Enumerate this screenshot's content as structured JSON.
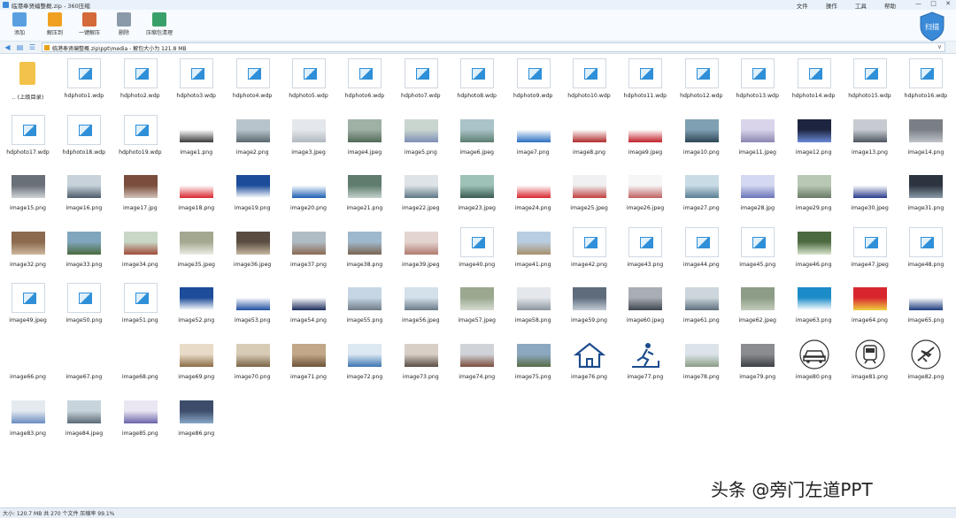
{
  "window": {
    "title": "临港奉贤编整概.zip - 360压缩",
    "menus": [
      "文件",
      "操作",
      "工具",
      "帮助"
    ],
    "controls": [
      "—",
      "□",
      "✕"
    ]
  },
  "toolbar": {
    "buttons": [
      {
        "label": "添加",
        "icon": "add-icon",
        "color": "#5aa0e0"
      },
      {
        "label": "解压到",
        "icon": "extract-to-icon",
        "color": "#f0a020"
      },
      {
        "label": "一键解压",
        "icon": "one-click-extract-icon",
        "color": "#d46a3a"
      },
      {
        "label": "删除",
        "icon": "delete-icon",
        "color": "#8a9aa8"
      },
      {
        "label": "压缩包清理",
        "icon": "archive-clean-icon",
        "color": "#3aa06a"
      }
    ],
    "shield_label": "扫描"
  },
  "address": {
    "path": "临港奉贤编整概.zip\\ppt\\media - 解包大小为 121.8 MB"
  },
  "files": [
    {
      "name": ".. (上级目录)",
      "kind": "folder"
    },
    {
      "name": "hdphoto1.wdp",
      "kind": "doc"
    },
    {
      "name": "hdphoto2.wdp",
      "kind": "doc"
    },
    {
      "name": "hdphoto3.wdp",
      "kind": "doc"
    },
    {
      "name": "hdphoto4.wdp",
      "kind": "doc"
    },
    {
      "name": "hdphoto5.wdp",
      "kind": "doc"
    },
    {
      "name": "hdphoto6.wdp",
      "kind": "doc"
    },
    {
      "name": "hdphoto7.wdp",
      "kind": "doc"
    },
    {
      "name": "hdphoto8.wdp",
      "kind": "doc"
    },
    {
      "name": "hdphoto9.wdp",
      "kind": "doc"
    },
    {
      "name": "hdphoto10.wdp",
      "kind": "doc"
    },
    {
      "name": "hdphoto11.wdp",
      "kind": "doc"
    },
    {
      "name": "hdphoto12.wdp",
      "kind": "doc"
    },
    {
      "name": "hdphoto13.wdp",
      "kind": "doc"
    },
    {
      "name": "hdphoto14.wdp",
      "kind": "doc"
    },
    {
      "name": "hdphoto15.wdp",
      "kind": "doc"
    },
    {
      "name": "hdphoto16.wdp",
      "kind": "doc"
    },
    {
      "name": "hdphoto17.wdp",
      "kind": "doc"
    },
    {
      "name": "hdphoto18.wdp",
      "kind": "doc"
    },
    {
      "name": "hdphoto19.wdp",
      "kind": "doc"
    },
    {
      "name": "image1.png",
      "kind": "img",
      "colors": [
        "#ffffff",
        "#3a3a3a"
      ]
    },
    {
      "name": "image2.png",
      "kind": "img",
      "colors": [
        "#b8c4cc",
        "#5a6870"
      ]
    },
    {
      "name": "image3.jpeg",
      "kind": "img",
      "colors": [
        "#e4e8ec",
        "#b0b8bf"
      ]
    },
    {
      "name": "image4.jpeg",
      "kind": "img",
      "colors": [
        "#9fb0a4",
        "#526a58"
      ]
    },
    {
      "name": "image5.png",
      "kind": "img",
      "colors": [
        "#c9d6d0",
        "#7d8fb5"
      ]
    },
    {
      "name": "image6.jpeg",
      "kind": "img",
      "colors": [
        "#a9c3c8",
        "#5d7e70"
      ]
    },
    {
      "name": "image7.png",
      "kind": "img",
      "colors": [
        "#ffffff",
        "#2a6fc0"
      ]
    },
    {
      "name": "image8.png",
      "kind": "img",
      "colors": [
        "#ffffff",
        "#b02b2b"
      ]
    },
    {
      "name": "image9.jpeg",
      "kind": "img",
      "colors": [
        "#ffffff",
        "#c0202a"
      ]
    },
    {
      "name": "image10.png",
      "kind": "img",
      "colors": [
        "#7f9fb2",
        "#2e4656"
      ]
    },
    {
      "name": "image11.jpeg",
      "kind": "img",
      "colors": [
        "#d9d4ea",
        "#8a86b0"
      ]
    },
    {
      "name": "image12.png",
      "kind": "img",
      "colors": [
        "#1d2440",
        "#6a8ad6"
      ]
    },
    {
      "name": "image13.png",
      "kind": "img",
      "colors": [
        "#c7cbd1",
        "#4f5660"
      ]
    },
    {
      "name": "image14.png",
      "kind": "img",
      "colors": [
        "#7a7f86",
        "#c0c4c9"
      ]
    },
    {
      "name": "image15.png",
      "kind": "img",
      "colors": [
        "#6a7078",
        "#cfd3d8"
      ]
    },
    {
      "name": "image16.png",
      "kind": "img",
      "colors": [
        "#c7d2da",
        "#4d5c6a"
      ]
    },
    {
      "name": "image17.jpg",
      "kind": "img",
      "colors": [
        "#7a4d3c",
        "#d2c2b8"
      ]
    },
    {
      "name": "image18.png",
      "kind": "img",
      "colors": [
        "#ffffff",
        "#d8262e"
      ]
    },
    {
      "name": "image19.png",
      "kind": "img",
      "colors": [
        "#1c4c9a",
        "#ffffff"
      ]
    },
    {
      "name": "image20.png",
      "kind": "img",
      "colors": [
        "#ffffff",
        "#1c5fb2"
      ]
    },
    {
      "name": "image21.png",
      "kind": "img",
      "colors": [
        "#5f7c6e",
        "#c4d2cc"
      ]
    },
    {
      "name": "image22.jpeg",
      "kind": "img",
      "colors": [
        "#dde3e6",
        "#5e7786"
      ]
    },
    {
      "name": "image23.jpeg",
      "kind": "img",
      "colors": [
        "#9ec2b8",
        "#3a5a52"
      ]
    },
    {
      "name": "image24.png",
      "kind": "img",
      "colors": [
        "#ffffff",
        "#d8262e"
      ]
    },
    {
      "name": "image25.jpeg",
      "kind": "img",
      "colors": [
        "#f0f0f2",
        "#c24040"
      ]
    },
    {
      "name": "image26.jpeg",
      "kind": "img",
      "colors": [
        "#f6f6f6",
        "#c06060"
      ]
    },
    {
      "name": "image27.png",
      "kind": "img",
      "colors": [
        "#c9dce6",
        "#5a7e94"
      ]
    },
    {
      "name": "image28.jpg",
      "kind": "img",
      "colors": [
        "#d4d8f0",
        "#6a74b8"
      ]
    },
    {
      "name": "image29.png",
      "kind": "img",
      "colors": [
        "#b8c8b4",
        "#6a7a66"
      ]
    },
    {
      "name": "image30.jpeg",
      "kind": "img",
      "colors": [
        "#ffffff",
        "#2a3c8c"
      ]
    },
    {
      "name": "image31.png",
      "kind": "img",
      "colors": [
        "#2c3440",
        "#8a9aa8"
      ]
    },
    {
      "name": "image32.png",
      "kind": "img",
      "colors": [
        "#8c6a4e",
        "#cdb89e"
      ]
    },
    {
      "name": "image33.png",
      "kind": "img",
      "colors": [
        "#7fa6bc",
        "#4a6a3e"
      ]
    },
    {
      "name": "image34.png",
      "kind": "img",
      "colors": [
        "#c9d8c6",
        "#a04a3a"
      ]
    },
    {
      "name": "image35.jpeg",
      "kind": "img",
      "colors": [
        "#a4a890",
        "#ecece4"
      ]
    },
    {
      "name": "image36.jpeg",
      "kind": "img",
      "colors": [
        "#5a4c40",
        "#c7b8a2"
      ]
    },
    {
      "name": "image37.png",
      "kind": "img",
      "colors": [
        "#b0bcc4",
        "#8a6a52"
      ]
    },
    {
      "name": "image38.png",
      "kind": "img",
      "colors": [
        "#9fb8cc",
        "#7a6450"
      ]
    },
    {
      "name": "image39.jpeg",
      "kind": "img",
      "colors": [
        "#e4d4d0",
        "#b07a70"
      ]
    },
    {
      "name": "image40.png",
      "kind": "doc"
    },
    {
      "name": "image41.png",
      "kind": "img",
      "colors": [
        "#b9cde0",
        "#a8906c"
      ]
    },
    {
      "name": "image42.png",
      "kind": "doc"
    },
    {
      "name": "image43.png",
      "kind": "doc"
    },
    {
      "name": "image44.png",
      "kind": "doc"
    },
    {
      "name": "image45.png",
      "kind": "doc"
    },
    {
      "name": "image46.png",
      "kind": "img",
      "colors": [
        "#4c6a40",
        "#d8e4cc"
      ]
    },
    {
      "name": "image47.jpeg",
      "kind": "doc"
    },
    {
      "name": "image48.png",
      "kind": "doc"
    },
    {
      "name": "image49.jpeg",
      "kind": "doc"
    },
    {
      "name": "image50.png",
      "kind": "doc"
    },
    {
      "name": "image51.png",
      "kind": "doc"
    },
    {
      "name": "image52.png",
      "kind": "img",
      "colors": [
        "#1c4c9a",
        "#ffffff"
      ]
    },
    {
      "name": "image53.png",
      "kind": "img",
      "colors": [
        "#ffffff",
        "#2050a0"
      ]
    },
    {
      "name": "image54.png",
      "kind": "img",
      "colors": [
        "#ffffff",
        "#1c2c5c"
      ]
    },
    {
      "name": "image55.png",
      "kind": "img",
      "colors": [
        "#c6d6e4",
        "#707c88"
      ]
    },
    {
      "name": "image56.jpeg",
      "kind": "img",
      "colors": [
        "#d4e0ea",
        "#6a7a86"
      ]
    },
    {
      "name": "image57.jpeg",
      "kind": "img",
      "colors": [
        "#9aa890",
        "#d8dcd2"
      ]
    },
    {
      "name": "image58.png",
      "kind": "img",
      "colors": [
        "#e4e8ec",
        "#8a949e"
      ]
    },
    {
      "name": "image59.png",
      "kind": "img",
      "colors": [
        "#5e6c7c",
        "#c4ccd6"
      ]
    },
    {
      "name": "image60.jpeg",
      "kind": "img",
      "colors": [
        "#a8aeb4",
        "#3e4650"
      ]
    },
    {
      "name": "image61.png",
      "kind": "img",
      "colors": [
        "#cdd6dc",
        "#5c6e7c"
      ]
    },
    {
      "name": "image62.jpeg",
      "kind": "img",
      "colors": [
        "#8c9c86",
        "#c4ccbc"
      ]
    },
    {
      "name": "image63.png",
      "kind": "img",
      "colors": [
        "#1c8cc8",
        "#ffffff"
      ]
    },
    {
      "name": "image64.png",
      "kind": "img",
      "colors": [
        "#d8262e",
        "#f0d040"
      ]
    },
    {
      "name": "image65.png",
      "kind": "img",
      "colors": [
        "#ffffff",
        "#1c3c7c"
      ]
    },
    {
      "name": "image66.png",
      "kind": "blank"
    },
    {
      "name": "image67.png",
      "kind": "blank"
    },
    {
      "name": "image68.png",
      "kind": "blank"
    },
    {
      "name": "image69.png",
      "kind": "img",
      "colors": [
        "#e8dcc8",
        "#8c6c48"
      ]
    },
    {
      "name": "image70.png",
      "kind": "img",
      "colors": [
        "#d8ccb6",
        "#7a6448"
      ]
    },
    {
      "name": "image71.png",
      "kind": "img",
      "colors": [
        "#c2a888",
        "#6c5438"
      ]
    },
    {
      "name": "image72.png",
      "kind": "img",
      "colors": [
        "#dce8f2",
        "#3c74b0"
      ]
    },
    {
      "name": "image73.png",
      "kind": "img",
      "colors": [
        "#d8cfc6",
        "#5a4c44"
      ]
    },
    {
      "name": "image74.png",
      "kind": "img",
      "colors": [
        "#d0d4d8",
        "#7c4c3c"
      ]
    },
    {
      "name": "image75.png",
      "kind": "img",
      "colors": [
        "#8ca8c0",
        "#5a6c48"
      ]
    },
    {
      "name": "image76.png",
      "kind": "icon",
      "icon": "house-icon",
      "colors": [
        "#ffffff",
        "#1c4c8c"
      ]
    },
    {
      "name": "image77.png",
      "kind": "icon",
      "icon": "treadmill-icon",
      "colors": [
        "#ffffff",
        "#1c4c8c"
      ]
    },
    {
      "name": "image78.png",
      "kind": "img",
      "colors": [
        "#dce4ea",
        "#8a9c84"
      ]
    },
    {
      "name": "image79.png",
      "kind": "img",
      "colors": [
        "#8a8c90",
        "#3c4046"
      ]
    },
    {
      "name": "image80.png",
      "kind": "icon",
      "icon": "car-icon",
      "colors": [
        "#ffffff",
        "#333333"
      ]
    },
    {
      "name": "image81.png",
      "kind": "icon",
      "icon": "train-icon",
      "colors": [
        "#ffffff",
        "#333333"
      ]
    },
    {
      "name": "image82.png",
      "kind": "icon",
      "icon": "airplane-icon",
      "colors": [
        "#ffffff",
        "#333333"
      ]
    },
    {
      "name": "image83.png",
      "kind": "img",
      "colors": [
        "#e4eaf0",
        "#6a8cc0"
      ]
    },
    {
      "name": "image84.jpeg",
      "kind": "img",
      "colors": [
        "#c8d4dc",
        "#5c6a76"
      ]
    },
    {
      "name": "image85.png",
      "kind": "img",
      "colors": [
        "#eae6f2",
        "#6a64a8"
      ]
    },
    {
      "name": "image86.png",
      "kind": "img",
      "colors": [
        "#3c4c6a",
        "#8aa8c8"
      ]
    }
  ],
  "watermark": "头条 @旁门左道PPT",
  "status": "大小: 120.7 MB 共 270 个文件 压缩率 99.1%"
}
